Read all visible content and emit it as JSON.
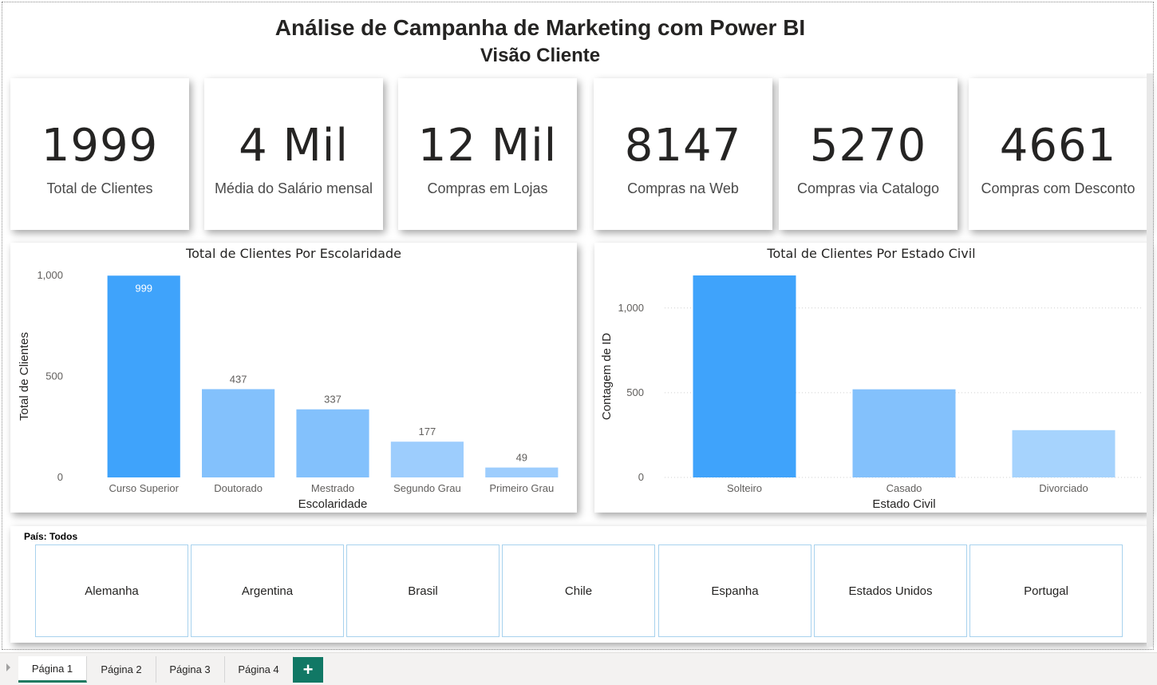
{
  "header": {
    "title": "Análise de Campanha de Marketing com Power BI",
    "subtitle": "Visão Cliente"
  },
  "kpis": [
    {
      "value": "1999",
      "label": "Total de Clientes"
    },
    {
      "value": "4 Mil",
      "label": "Média do Salário mensal"
    },
    {
      "value": "12 Mil",
      "label": "Compras em Lojas"
    },
    {
      "value": "8147",
      "label": "Compras na Web"
    },
    {
      "value": "5270",
      "label": "Compras via Catalogo"
    },
    {
      "value": "4661",
      "label": "Compras com Desconto"
    }
  ],
  "chart_data": [
    {
      "type": "bar",
      "title": "Total de Clientes Por Escolaridade",
      "xlabel": "Escolaridade",
      "ylabel": "Total de Clientes",
      "categories": [
        "Curso Superior",
        "Doutorado",
        "Mestrado",
        "Segundo Grau",
        "Primeiro Grau"
      ],
      "values": [
        999,
        437,
        337,
        177,
        49
      ],
      "data_labels": [
        "999",
        "437",
        "337",
        "177",
        "49"
      ],
      "yticks": [
        0,
        500,
        1000
      ],
      "ytick_labels": [
        "0",
        "500",
        "1,000"
      ],
      "ylim": [
        0,
        1000
      ],
      "grid": false,
      "colors": [
        "#3fa3fb",
        "#83c1fc",
        "#83c1fc",
        "#9dcdfd",
        "#9dcdfd"
      ]
    },
    {
      "type": "bar",
      "title": "Total de Clientes Por Estado Civil",
      "xlabel": "Estado Civil",
      "ylabel": "Contagem de ID",
      "categories": [
        "Solteiro",
        "Casado",
        "Divorciado"
      ],
      "values": [
        1192,
        520,
        279
      ],
      "yticks": [
        0,
        500,
        1000
      ],
      "ytick_labels": [
        "0",
        "500",
        "1,000"
      ],
      "ylim": [
        0,
        1192
      ],
      "grid": true,
      "colors": [
        "#3fa3fb",
        "#83c1fc",
        "#a6d3fd"
      ]
    }
  ],
  "slicer": {
    "header": "País: Todos",
    "options": [
      "Alemanha",
      "Argentina",
      "Brasil",
      "Chile",
      "Espanha",
      "Estados Unidos",
      "Portugal"
    ]
  },
  "tabs": {
    "items": [
      "Página 1",
      "Página 2",
      "Página 3",
      "Página 4"
    ],
    "active": "Página 1",
    "add_label": "+"
  }
}
